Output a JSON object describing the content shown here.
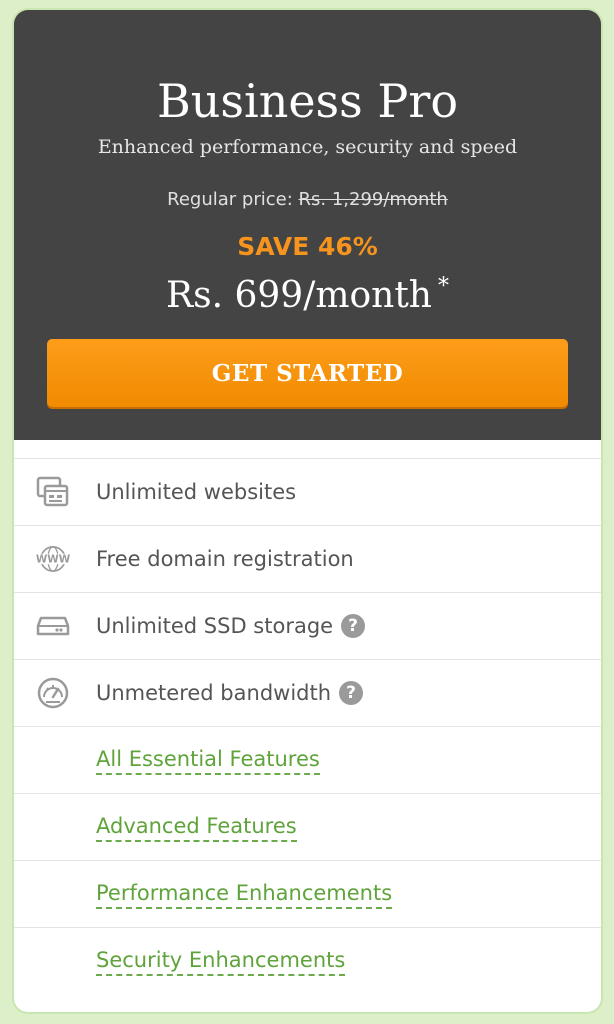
{
  "plan": {
    "title": "Business Pro",
    "subtitle": "Enhanced performance, security and speed",
    "regular_price_label": "Regular price:",
    "regular_price_value": "Rs. 1,299/month",
    "save_text": "SAVE 46%",
    "price": "Rs. 699/month",
    "price_asterisk": "*",
    "cta_label": "GET STARTED"
  },
  "features": [
    {
      "label": "Unlimited websites",
      "icon": "websites-icon"
    },
    {
      "label": "Free domain registration",
      "icon": "www-globe-icon"
    },
    {
      "label": "Unlimited SSD storage",
      "icon": "ssd-drive-icon",
      "help": "?"
    },
    {
      "label": "Unmetered bandwidth",
      "icon": "speedometer-icon",
      "help": "?"
    }
  ],
  "links": [
    {
      "label": "All Essential Features"
    },
    {
      "label": "Advanced Features"
    },
    {
      "label": "Performance Enhancements"
    },
    {
      "label": "Security Enhancements"
    }
  ],
  "colors": {
    "page_background": "#dcefc9",
    "header_background": "#444444",
    "accent_orange": "#f7941d",
    "link_green": "#5fa33b",
    "feature_text": "#555555"
  }
}
